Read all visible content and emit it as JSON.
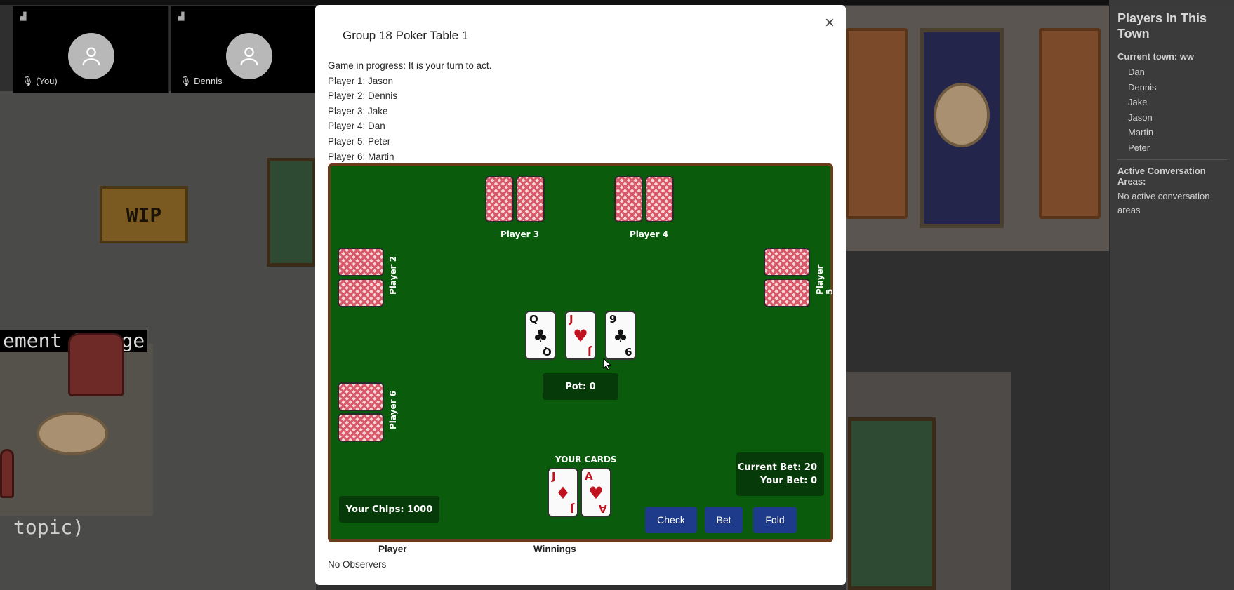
{
  "video_tiles": [
    {
      "label": "(You)"
    },
    {
      "label": "Dennis"
    }
  ],
  "world": {
    "sign_text": "WIP",
    "area_label": "ement Lounge",
    "topic_text": "topic)"
  },
  "sidebar": {
    "title": "Players In This Town",
    "current_town": "Current town: ww",
    "players": [
      "Dan",
      "Dennis",
      "Jake",
      "Jason",
      "Martin",
      "Peter"
    ],
    "active_heading": "Active Conversation Areas:",
    "active_empty": "No active conversation areas"
  },
  "modal": {
    "title": "Group 18 Poker Table 1",
    "close_label": "×",
    "status": "Game in progress: It is your turn to act.",
    "player_lines": [
      "Player 1: Jason",
      "Player 2: Dennis",
      "Player 3: Jake",
      "Player 4: Dan",
      "Player 5: Peter",
      "Player 6: Martin"
    ],
    "footer": {
      "player_col": "Player",
      "winnings_col": "Winnings",
      "observers": "No Observers"
    }
  },
  "table": {
    "seats": {
      "p2": "Player 2",
      "p3": "Player 3",
      "p4": "Player 4",
      "p5": "Player 5",
      "p6": "Player 6"
    },
    "community_cards": [
      {
        "rank": "Q",
        "suit": "♣",
        "color": "black"
      },
      {
        "rank": "J",
        "suit": "♥",
        "color": "red"
      },
      {
        "rank": "9",
        "suit": "♣",
        "color": "black"
      }
    ],
    "pot_label": "Pot: 0",
    "your_cards_label": "YOUR CARDS",
    "your_cards": [
      {
        "rank": "J",
        "suit": "♦",
        "color": "red"
      },
      {
        "rank": "A",
        "suit": "♥",
        "color": "red"
      }
    ],
    "current_bet": "Current Bet: 20",
    "your_bet": "Your Bet: 0",
    "chips": "Your Chips: 1000",
    "buttons": {
      "check": "Check",
      "bet": "Bet",
      "fold": "Fold"
    }
  },
  "colors": {
    "felt": "#0a5c0c",
    "rail": "#6b3b1c",
    "button": "#1e3a8a",
    "card_red": "#c1121f"
  }
}
